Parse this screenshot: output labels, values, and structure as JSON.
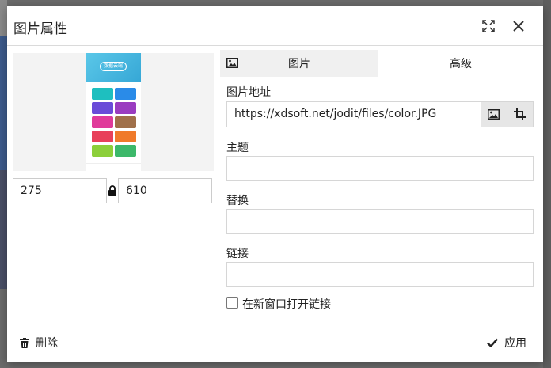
{
  "dialog": {
    "title": "图片属性"
  },
  "preview": {
    "logo_text": "数据云端"
  },
  "size": {
    "width": "275",
    "height": "610"
  },
  "tabs": [
    {
      "label": "图片",
      "active": true
    },
    {
      "label": "高级",
      "active": false
    }
  ],
  "fields": {
    "src_label": "图片地址",
    "src_value": "https://xdsoft.net/jodit/files/color.JPG",
    "title_label": "主题",
    "title_value": "",
    "alt_label": "替换",
    "alt_value": "",
    "link_label": "链接",
    "link_value": ""
  },
  "checkbox": {
    "label": "在新窗口打开链接",
    "checked": false
  },
  "footer": {
    "delete_label": "删除",
    "apply_label": "应用"
  },
  "icons": {
    "fullsize": "fullsize-icon",
    "close": "close-icon",
    "image": "image-icon",
    "crop": "crop-icon",
    "lock": "lock-icon",
    "trash": "trash-icon",
    "check": "check-icon"
  }
}
